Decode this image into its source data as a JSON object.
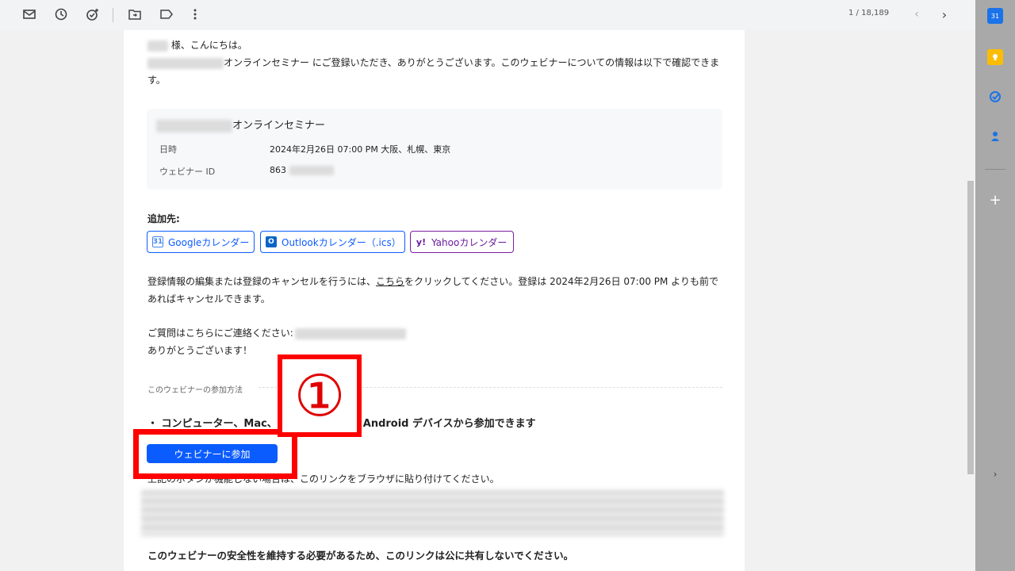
{
  "toolbar": {
    "icons": [
      "mail-mark-unread-icon",
      "snooze-icon",
      "add-task-icon",
      "move-to-icon",
      "label-icon",
      "more-vert-icon"
    ],
    "pager": "1 / 18,189"
  },
  "email": {
    "greeting_suffix": "様、こんにちは。",
    "intro": "オンラインセミナー にご登録いただき、ありがとうございます。このウェビナーについての情報は以下で確認できます。",
    "info_box": {
      "title": "オンラインセミナー",
      "date_label": "日時",
      "date_value": "2024年2月26日 07:00 PM 大阪、札幌、東京",
      "id_label": "ウェビナー ID",
      "id_value_prefix": "863"
    },
    "add_to_label": "追加先:",
    "calendar_buttons": [
      {
        "label": "Googleカレンダー",
        "icon": "google-calendar-icon"
      },
      {
        "label": "Outlookカレンダー（.ics）",
        "icon": "outlook-icon"
      },
      {
        "label": "Yahooカレンダー",
        "icon": "yahoo-icon"
      }
    ],
    "cancel_before": "登録情報の編集または登録のキャンセルを行うには、",
    "cancel_link": "こちら",
    "cancel_after": "をクリックしてください。登録は 2024年2月26日 07:00 PM よりも前であればキャンセルできます。",
    "question": "ご質問はこちらにご連絡ください:",
    "thanks": "ありがとうございます！",
    "join_section_label": "このウェビナーの参加方法",
    "device_line": "・ コンピューター、Mac、iPad、iPhone、Android デバイスから参加できます",
    "join_button": "ウェビナーに参加",
    "fallback_text": "上記のボタンが機能しない場合は、このリンクをブラウザに貼り付けてください。",
    "warning": "このウェビナーの安全性を維持する必要があるため、このリンクは公に共有しないでください。"
  },
  "annotation": {
    "step_number": "①",
    "color": "#ff0000"
  },
  "colors": {
    "accent": "#0b5cff",
    "yahoo": "#6a1b9a"
  }
}
